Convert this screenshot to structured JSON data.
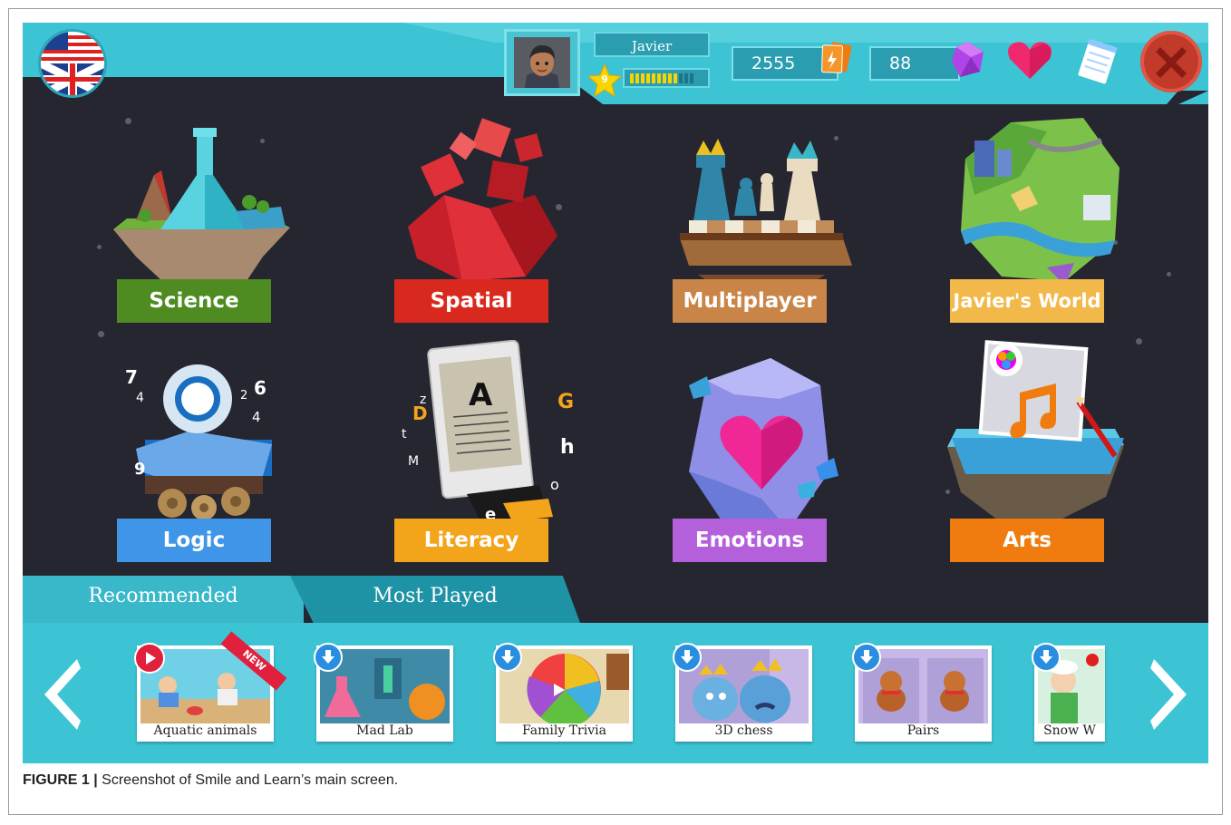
{
  "profile": {
    "name": "Javier",
    "level": "9",
    "xp_filled": 0.75
  },
  "counters": {
    "coins": "2555",
    "gems": "88"
  },
  "icons": {
    "language": "uk-flag-icon",
    "coins": "cards-icon",
    "gems": "gem-icon",
    "favorites": "heart-icon",
    "notes": "notepad-icon",
    "close": "close-icon"
  },
  "categories": [
    {
      "label": "Science",
      "color": "#4e8c22"
    },
    {
      "label": "Spatial",
      "color": "#d9291f"
    },
    {
      "label": "Multiplayer",
      "color": "#c98447"
    },
    {
      "label": "Javier's World",
      "color": "#f2b94a"
    },
    {
      "label": "Logic",
      "color": "#3f95e8"
    },
    {
      "label": "Literacy",
      "color": "#f2a41a"
    },
    {
      "label": "Emotions",
      "color": "#b560db"
    },
    {
      "label": "Arts",
      "color": "#f07c10"
    }
  ],
  "tabs": {
    "recommended": "Recommended",
    "most_played": "Most Played"
  },
  "games": [
    {
      "title": "Aquatic animals",
      "badge": "play",
      "ribbon": "NEW"
    },
    {
      "title": "Mad Lab",
      "badge": "download"
    },
    {
      "title": "Family Trivia",
      "badge": "download"
    },
    {
      "title": "3D chess",
      "badge": "download"
    },
    {
      "title": "Pairs",
      "badge": "download"
    },
    {
      "title": "Snow W",
      "badge": "download"
    }
  ],
  "caption": {
    "label": "FIGURE 1 |",
    "text": " Screenshot of Smile and Learn’s main screen."
  }
}
